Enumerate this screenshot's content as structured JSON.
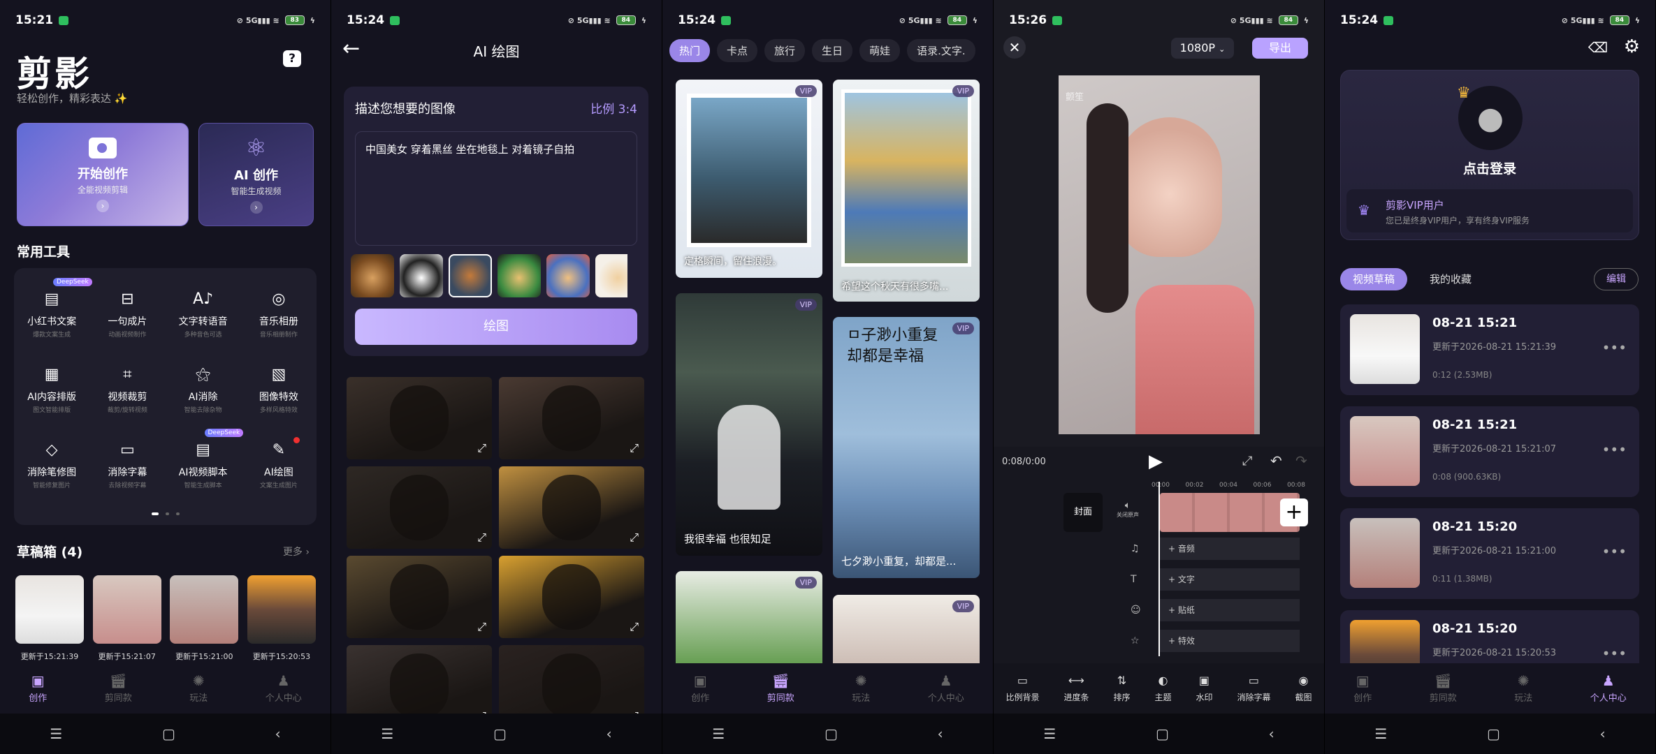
{
  "colors": {
    "accent": "#c9a6ff",
    "bg": "#14131f",
    "card": "#221f35"
  },
  "s1": {
    "status": {
      "time": "15:21",
      "battery": "83"
    },
    "app_title": "剪影",
    "tagline": "轻松创作，精彩表达 ✨",
    "card_create": {
      "title": "开始创作",
      "sub": "全能视频剪辑"
    },
    "card_ai": {
      "title": "AI 创作",
      "sub": "智能生成视频"
    },
    "tools_title": "常用工具",
    "tools": [
      {
        "label": "小红书文案",
        "sub": "爆款文案生成",
        "badge": "DeepSeek",
        "icon": "xhs-icon",
        "glyph": "▤"
      },
      {
        "label": "一句成片",
        "sub": "动画视频制作",
        "badge": "",
        "icon": "film-icon",
        "glyph": "⊟"
      },
      {
        "label": "文字转语音",
        "sub": "多种音色可选",
        "badge": "",
        "icon": "tts-icon",
        "glyph": "A♪"
      },
      {
        "label": "音乐相册",
        "sub": "音乐相册制作",
        "badge": "",
        "icon": "music-album-icon",
        "glyph": "◎"
      },
      {
        "label": "AI内容排版",
        "sub": "图文智能排版",
        "badge": "",
        "icon": "layout-icon",
        "glyph": "▦"
      },
      {
        "label": "视频裁剪",
        "sub": "裁剪/旋转视频",
        "badge": "",
        "icon": "crop-icon",
        "glyph": "⌗"
      },
      {
        "label": "AI消除",
        "sub": "智能去除杂物",
        "badge": "",
        "icon": "magic-wand-icon",
        "glyph": "⚝"
      },
      {
        "label": "图像特效",
        "sub": "多样风格特效",
        "badge": "",
        "icon": "image-effect-icon",
        "glyph": "▧"
      },
      {
        "label": "消除笔修图",
        "sub": "智能修复图片",
        "badge": "",
        "icon": "eraser-icon",
        "glyph": "◇"
      },
      {
        "label": "消除字幕",
        "sub": "去除视频字幕",
        "badge": "",
        "icon": "subtitle-icon",
        "glyph": "▭"
      },
      {
        "label": "AI视频脚本",
        "sub": "智能生成脚本",
        "badge": "DeepSeek",
        "icon": "script-icon",
        "glyph": "▤"
      },
      {
        "label": "AI绘图",
        "sub": "文案生成图片",
        "badge": "",
        "icon": "brush-icon",
        "glyph": "✎"
      }
    ],
    "drafts_title": "草稿箱 (4)",
    "more": "更多",
    "drafts": [
      "更新于15:21:39",
      "更新于15:21:07",
      "更新于15:21:00",
      "更新于15:20:53"
    ]
  },
  "nav": [
    "创作",
    "剪同款",
    "玩法",
    "个人中心"
  ],
  "s2": {
    "status": {
      "time": "15:24",
      "battery": "84"
    },
    "title": "AI 绘图",
    "prompt_title": "描述您想要的图像",
    "ratio": "比例 3:4",
    "prompt_text": "中国美女 穿着黑丝 坐在地毯上 对着镜子自拍",
    "draw_button": "绘图"
  },
  "s3": {
    "status": {
      "time": "15:24",
      "battery": "84"
    },
    "chips": [
      "热门",
      "卡点",
      "旅行",
      "生日",
      "萌娃",
      "语录.文字."
    ],
    "vip": "VIP",
    "captions": [
      "定格瞬间，留住浪漫。",
      "希望这个秋天有很多嘴...",
      "我很幸福 也很知足",
      "七夕渺小重复，却都是..."
    ]
  },
  "s4": {
    "status": {
      "time": "15:26",
      "battery": "84"
    },
    "resolution": "1080P",
    "export": "导出",
    "time": "0:08/0:00",
    "cover": "封面",
    "mute": "关闭原声",
    "ruler": [
      "00:00",
      "00:02",
      "00:04",
      "00:06",
      "00:08"
    ],
    "tracks": [
      "+ 音频",
      "+ 文字",
      "+ 贴纸",
      "+ 特效"
    ],
    "watermark": "颤笙",
    "tools": [
      "比例背景",
      "进度条",
      "排序",
      "主题",
      "水印",
      "消除字幕",
      "截图"
    ]
  },
  "s5": {
    "status": {
      "time": "15:24",
      "battery": "84"
    },
    "login": "点击登录",
    "vip_title": "剪影VIP用户",
    "vip_sub": "您已是终身VIP用户，享有终身VIP服务",
    "tabs": [
      "视频草稿",
      "我的收藏"
    ],
    "edit": "编辑",
    "drafts": [
      {
        "title": "08-21 15:21",
        "updated": "更新于2026-08-21 15:21:39",
        "meta": "0:12 (2.53MB)"
      },
      {
        "title": "08-21 15:21",
        "updated": "更新于2026-08-21 15:21:07",
        "meta": "0:08 (900.63KB)"
      },
      {
        "title": "08-21 15:20",
        "updated": "更新于2026-08-21 15:21:00",
        "meta": "0:11 (1.38MB)"
      },
      {
        "title": "08-21 15:20",
        "updated": "更新于2026-08-21 15:20:53",
        "meta": ""
      }
    ]
  }
}
